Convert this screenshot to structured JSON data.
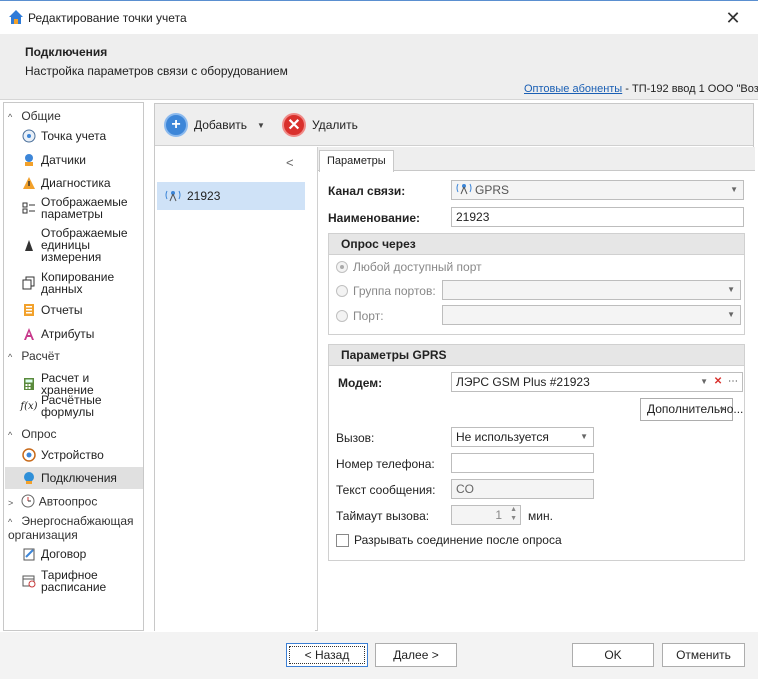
{
  "window": {
    "title": "Редактирование точки учета",
    "close_label": "✕"
  },
  "header": {
    "title": "Подключения",
    "description": "Настройка параметров связи с оборудованием",
    "path_link": "Оптовые абоненты",
    "path_rest": " - ТП-192 ввод 1 ООО \"Воз"
  },
  "nav": {
    "groups": [
      {
        "label": "Общие",
        "icon": "chevron-up-icon"
      },
      {
        "label": "Расчёт",
        "icon": "chevron-up-icon"
      },
      {
        "label": "Опрос",
        "icon": "chevron-up-icon"
      },
      {
        "label": "Энергоснабжающая организация",
        "icon": "chevron-up-icon"
      }
    ],
    "items": [
      {
        "label": "Точка учета",
        "icon": "meter-point-icon"
      },
      {
        "label": "Датчики",
        "icon": "sensor-icon"
      },
      {
        "label": "Диагностика",
        "icon": "warning-icon"
      },
      {
        "label": "Отображаемые параметры",
        "icon": "parameters-icon"
      },
      {
        "label": "Отображаемые единицы измерения",
        "icon": "units-icon"
      },
      {
        "label": "Копирование данных",
        "icon": "copy-icon"
      },
      {
        "label": "Отчеты",
        "icon": "report-icon"
      },
      {
        "label": "Атрибуты",
        "icon": "attributes-icon"
      },
      {
        "label": "Расчет и хранение",
        "icon": "calculator-icon"
      },
      {
        "label": "Расчётные формулы",
        "icon": "formula-icon"
      },
      {
        "label": "Устройство",
        "icon": "device-icon"
      },
      {
        "label": "Подключения",
        "icon": "connection-icon"
      },
      {
        "label": "Автоопрос",
        "icon": "clock-icon"
      },
      {
        "label": "Договор",
        "icon": "contract-icon"
      },
      {
        "label": "Тарифное расписание",
        "icon": "tariff-icon"
      }
    ]
  },
  "toolbar": {
    "add_label": "Добавить",
    "delete_label": "Удалить"
  },
  "list": {
    "items": [
      "21923"
    ]
  },
  "tabs": {
    "params": "Параметры"
  },
  "form": {
    "channel_label": "Канал связи:",
    "channel_value": "GPRS",
    "name_label": "Наименование:",
    "name_value": "21923",
    "poll_group_title": "Опрос через",
    "radio_any": "Любой доступный порт",
    "radio_group": "Группа портов:",
    "radio_port": "Порт:",
    "gprs_group_title": "Параметры GPRS",
    "modem_label": "Модем:",
    "modem_value": "ЛЭРС GSM Plus #21923",
    "advanced_label": "Дополнительно...",
    "call_label": "Вызов:",
    "call_value": "Не используется",
    "phone_label": "Номер телефона:",
    "phone_value": "",
    "sms_label": "Текст сообщения:",
    "sms_value": "CO",
    "timeout_label": "Таймаут вызова:",
    "timeout_value": "1",
    "timeout_unit": "мин.",
    "disconnect_label": "Разрывать соединение после опроса"
  },
  "footer": {
    "back_label": "< Назад",
    "next_label": "Далее >",
    "ok_label": "OK",
    "cancel_label": "Отменить"
  }
}
